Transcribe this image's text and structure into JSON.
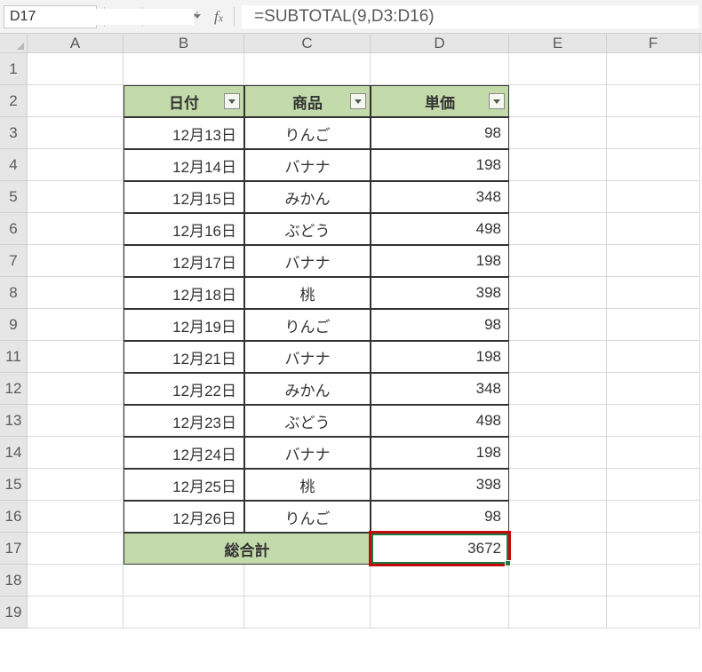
{
  "name_box": "D17",
  "formula": "=SUBTOTAL(9,D3:D16)",
  "columns": [
    "A",
    "B",
    "C",
    "D",
    "E",
    "F"
  ],
  "row_numbers": [
    "1",
    "2",
    "3",
    "4",
    "5",
    "6",
    "7",
    "8",
    "9",
    "11",
    "12",
    "13",
    "14",
    "15",
    "16",
    "17",
    "18",
    "19"
  ],
  "table": {
    "headers": {
      "b": "日付",
      "c": "商品",
      "d": "単価"
    },
    "rows": [
      {
        "date": "12月13日",
        "item": "りんご",
        "price": "98"
      },
      {
        "date": "12月14日",
        "item": "バナナ",
        "price": "198"
      },
      {
        "date": "12月15日",
        "item": "みかん",
        "price": "348"
      },
      {
        "date": "12月16日",
        "item": "ぶどう",
        "price": "498"
      },
      {
        "date": "12月17日",
        "item": "バナナ",
        "price": "198"
      },
      {
        "date": "12月18日",
        "item": "桃",
        "price": "398"
      },
      {
        "date": "12月19日",
        "item": "りんご",
        "price": "98"
      },
      {
        "date": "12月21日",
        "item": "バナナ",
        "price": "198"
      },
      {
        "date": "12月22日",
        "item": "みかん",
        "price": "348"
      },
      {
        "date": "12月23日",
        "item": "ぶどう",
        "price": "498"
      },
      {
        "date": "12月24日",
        "item": "バナナ",
        "price": "198"
      },
      {
        "date": "12月25日",
        "item": "桃",
        "price": "398"
      },
      {
        "date": "12月26日",
        "item": "りんご",
        "price": "98"
      }
    ],
    "total_label": "総合計",
    "total_value": "3672"
  }
}
